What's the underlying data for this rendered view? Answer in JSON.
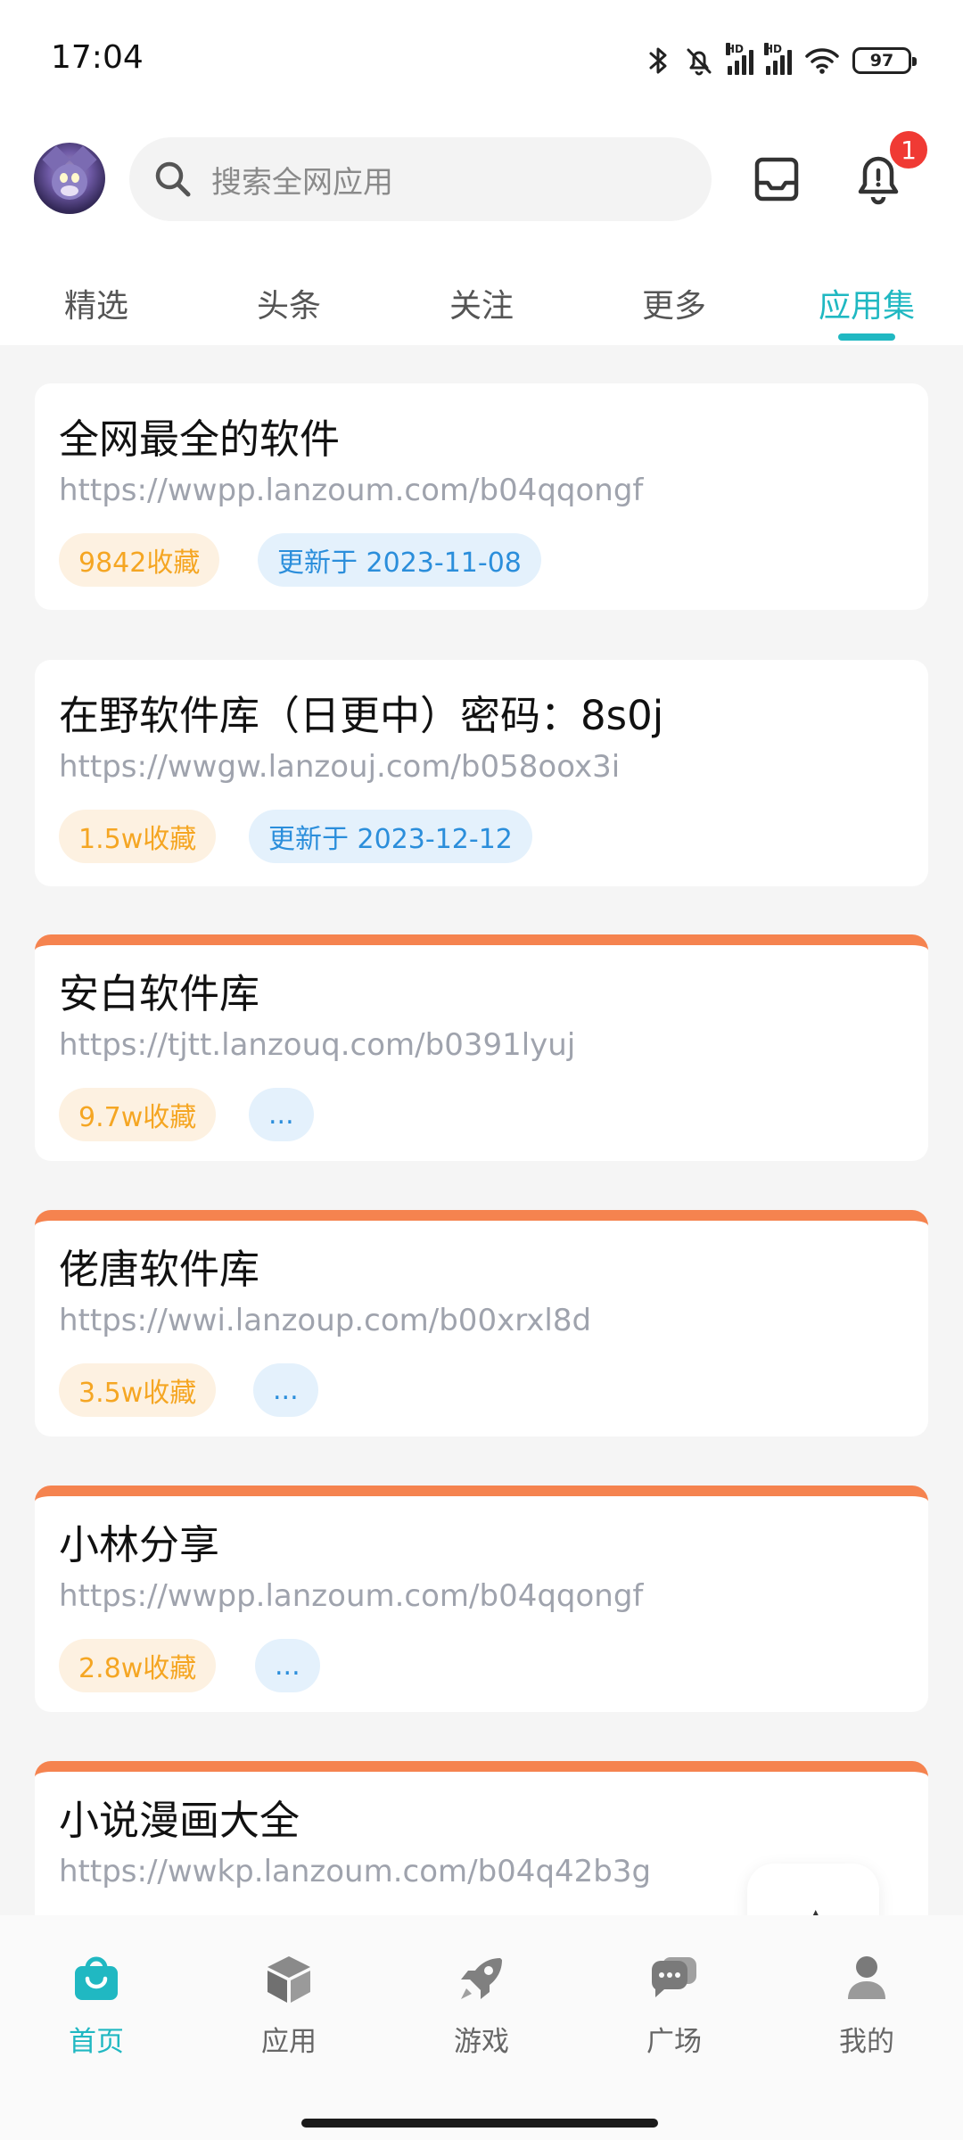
{
  "status_bar": {
    "time": "17:04",
    "battery": "97",
    "network_label": "HD"
  },
  "header": {
    "search_placeholder": "搜索全网应用",
    "notification_count": "1"
  },
  "tabs": [
    {
      "label": "精选",
      "active": false
    },
    {
      "label": "头条",
      "active": false
    },
    {
      "label": "关注",
      "active": false
    },
    {
      "label": "更多",
      "active": false
    },
    {
      "label": "应用集",
      "active": true
    }
  ],
  "cards": [
    {
      "title": "全网最全的软件",
      "url": "https://wwpp.lanzoum.com/b04qqongf",
      "favorites": "9842收藏",
      "update": "更新于 2023-11-08",
      "hot": false
    },
    {
      "title": "在野软件库（日更中）密码：8s0j",
      "url": "https://wwgw.lanzouj.com/b058oox3i",
      "favorites": "1.5w收藏",
      "update": "更新于 2023-12-12",
      "hot": false
    },
    {
      "title": "安白软件库",
      "url": "https://tjtt.lanzouq.com/b0391lyuj",
      "favorites": "9.7w收藏",
      "update": "...",
      "hot": true
    },
    {
      "title": "佬唐软件库",
      "url": "https://wwi.lanzoup.com/b00xrxl8d",
      "favorites": "3.5w收藏",
      "update": "...",
      "hot": true
    },
    {
      "title": "小林分享",
      "url": "https://wwpp.lanzoum.com/b04qqongf",
      "favorites": "2.8w收藏",
      "update": "...",
      "hot": true
    },
    {
      "title": "小说漫画大全",
      "url": "https://wwkp.lanzoum.com/b04q42b3g",
      "favorites": "",
      "update": "",
      "hot": true
    }
  ],
  "bottom_nav": [
    {
      "label": "首页",
      "icon": "bag-icon",
      "active": true
    },
    {
      "label": "应用",
      "icon": "cube-icon",
      "active": false
    },
    {
      "label": "游戏",
      "icon": "rocket-icon",
      "active": false
    },
    {
      "label": "广场",
      "icon": "chat-bubbles-icon",
      "active": false
    },
    {
      "label": "我的",
      "icon": "person-icon",
      "active": false
    }
  ],
  "colors": {
    "accent": "#20b8c2",
    "hot_bar": "#f5834f",
    "favorite_text": "#f5a623",
    "update_text": "#2b8edb",
    "badge": "#f03a34"
  }
}
